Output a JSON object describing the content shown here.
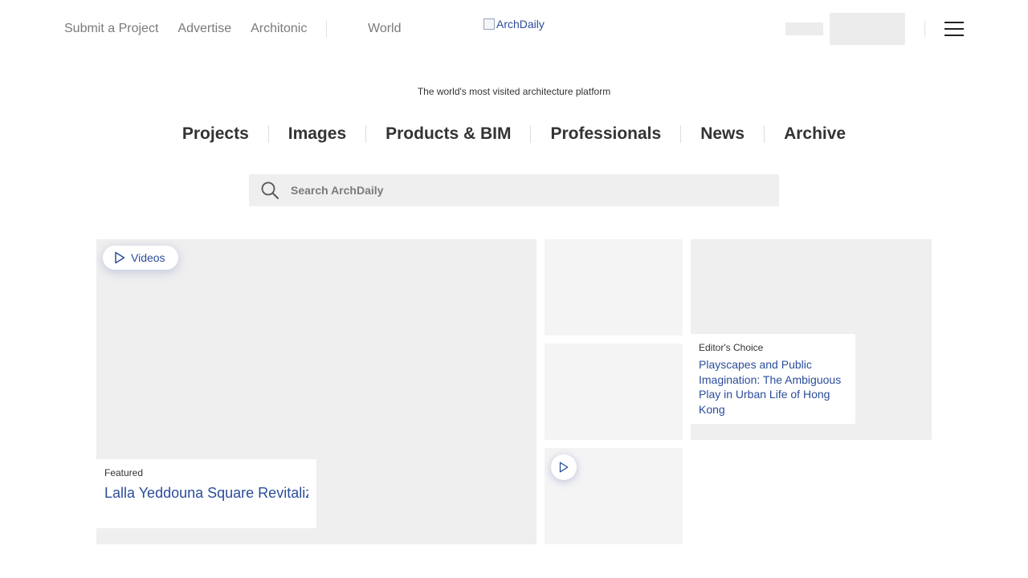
{
  "topbar": {
    "links": [
      "Submit a Project",
      "Advertise",
      "Architonic"
    ],
    "world": "World",
    "logo_alt": "ArchDaily"
  },
  "tagline": "The world's most visited architecture platform",
  "nav": [
    "Projects",
    "Images",
    "Products & BIM",
    "Professionals",
    "News",
    "Archive"
  ],
  "search": {
    "placeholder": "Search ArchDaily",
    "value": ""
  },
  "featured": {
    "badge": "Videos",
    "label": "Featured",
    "title": "Lalla Yeddouna Square Revitalization / Mossessian…"
  },
  "editors_choice": {
    "label": "Editor's Choice",
    "title": "Playscapes and Public Imagination: The Ambiguous Play in Urban Life of Hong Kong"
  },
  "colors": {
    "link_blue": "#2b4d9b",
    "placeholder_grey": "#efefef"
  }
}
